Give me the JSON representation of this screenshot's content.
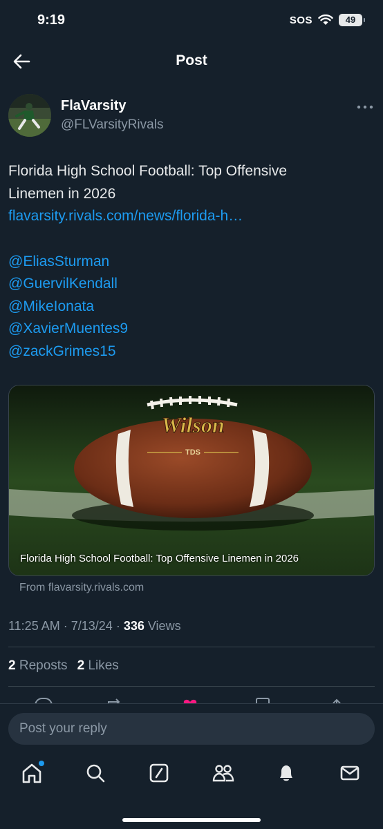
{
  "status": {
    "time": "9:19",
    "sos": "SOS",
    "battery": "49"
  },
  "header": {
    "title": "Post"
  },
  "author": {
    "name": "FlaVarsity",
    "handle": "@FLVarsityRivals"
  },
  "tweet": {
    "text_line1": "Florida High School Football: Top Offensive",
    "text_line2": "Linemen in 2026",
    "url": "flavarsity.rivals.com/news/florida-h…",
    "mentions": [
      "@EliasSturman",
      "@GuervilKendall",
      "@MikeIonata",
      "@XavierMuentes9",
      "@zackGrimes15"
    ]
  },
  "card": {
    "caption": "Florida High School Football: Top Offensive Linemen in 2026",
    "source": "From flavarsity.rivals.com",
    "ball_brand": "Wilson",
    "ball_model": "TDS"
  },
  "meta": {
    "time": "11:25 AM",
    "date": "7/13/24",
    "views_count": "336",
    "views_label": "Views"
  },
  "stats": {
    "reposts_count": "2",
    "reposts_label": "Reposts",
    "likes_count": "2",
    "likes_label": "Likes"
  },
  "reply": {
    "placeholder": "Post your reply"
  },
  "colors": {
    "background": "#15202b",
    "accent": "#1d9bf0",
    "muted": "#8b98a5",
    "like": "#f91880"
  },
  "tabbar": {
    "items": [
      "home-icon",
      "search-icon",
      "grok-icon",
      "communities-icon",
      "notifications-icon",
      "messages-icon"
    ]
  }
}
